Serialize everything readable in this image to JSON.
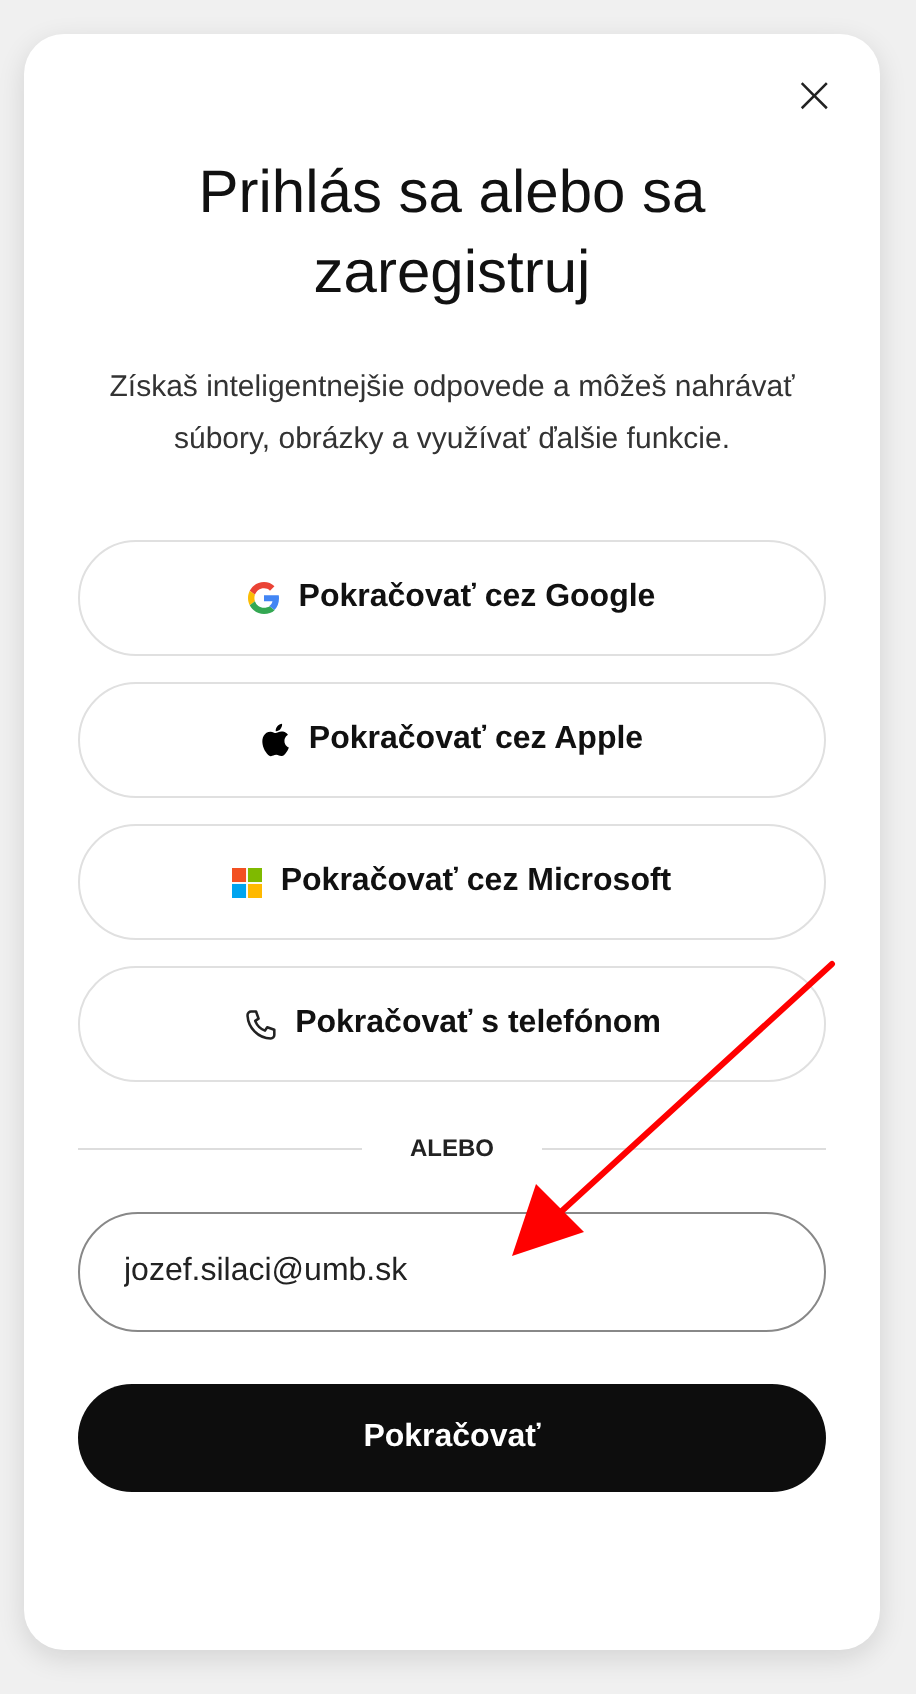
{
  "dialog": {
    "close": "×",
    "title": "Prihlás sa alebo sa zaregistruj",
    "subtitle": "Získaš inteligentnejšie odpovede a môžeš nahrávať súbory, obrázky a využívať ďalšie funkcie.",
    "providers": [
      {
        "kind": "google",
        "label": "Pokračovať cez Google"
      },
      {
        "kind": "apple",
        "label": "Pokračovať cez Apple"
      },
      {
        "kind": "microsoft",
        "label": "Pokračovať cez Microsoft"
      },
      {
        "kind": "phone",
        "label": "Pokračovať s telefónom"
      }
    ],
    "divider": "ALEBO",
    "email": {
      "value": "jozef.silaci@umb.sk"
    },
    "submit": "Pokračovať"
  }
}
